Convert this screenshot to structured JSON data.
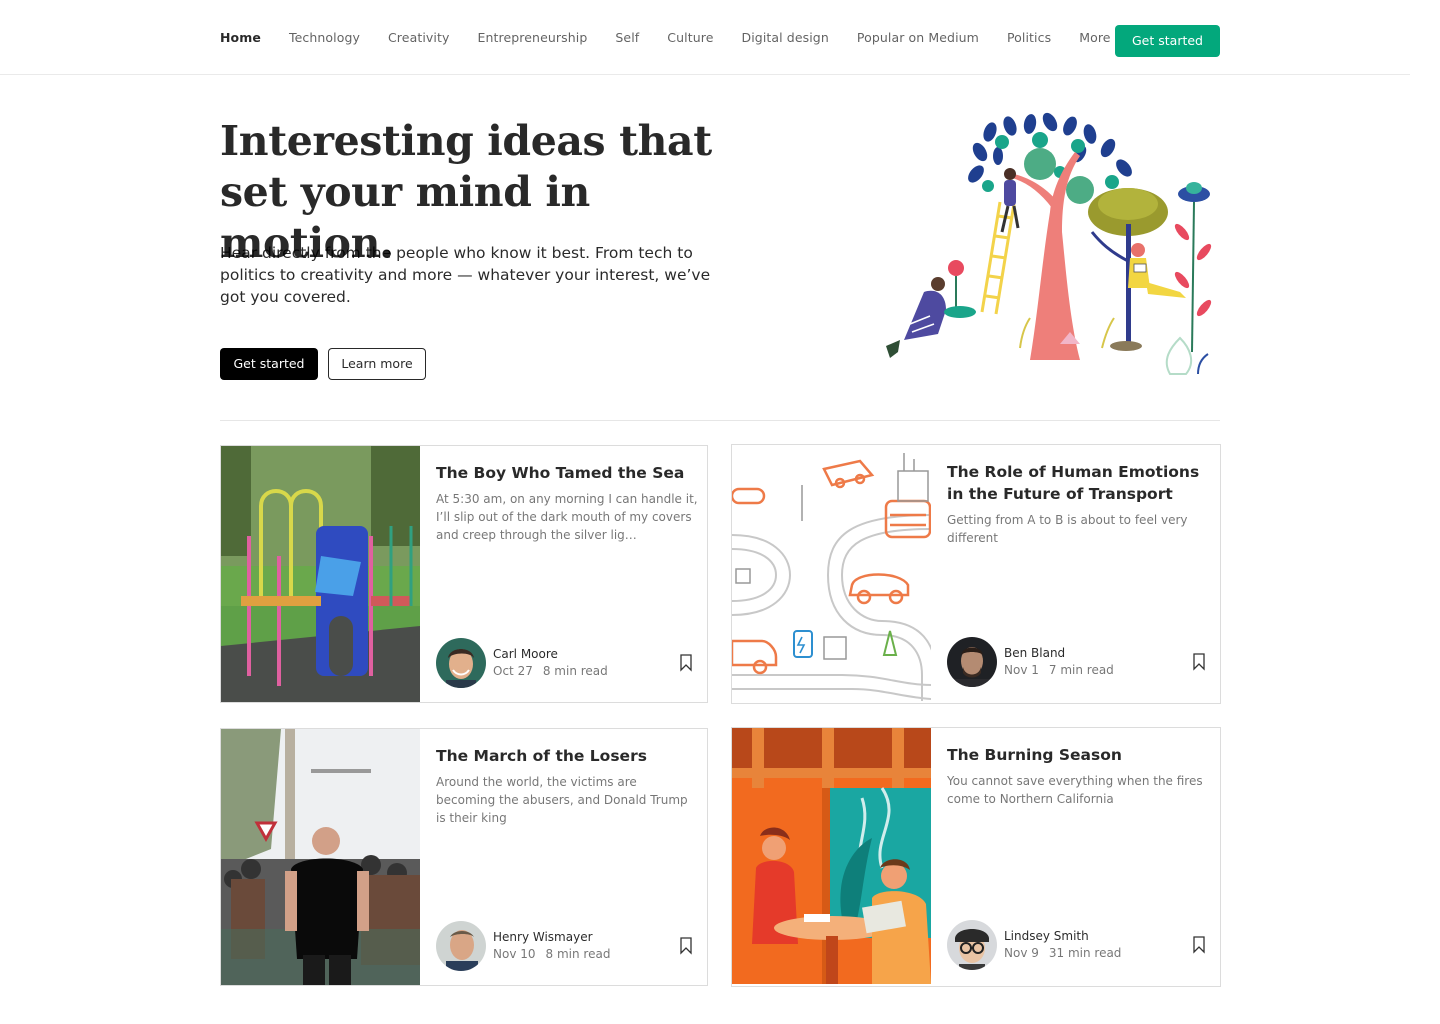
{
  "nav": {
    "items": [
      {
        "label": "Home",
        "active": true
      },
      {
        "label": "Technology"
      },
      {
        "label": "Creativity"
      },
      {
        "label": "Entrepreneurship"
      },
      {
        "label": "Self"
      },
      {
        "label": "Culture"
      },
      {
        "label": "Digital design"
      },
      {
        "label": "Popular on Medium"
      },
      {
        "label": "Politics"
      },
      {
        "label": "More"
      }
    ],
    "cta_label": "Get started"
  },
  "hero": {
    "title": "Interesting ideas that set your mind in motion.",
    "subtitle": "Hear directly from the people who know it best. From tech to politics to creativity and more — whatever your interest, we’ve got you covered.",
    "primary_label": "Get started",
    "secondary_label": "Learn more",
    "illustration_icon": "trees-and-people-illustration"
  },
  "colors": {
    "accent": "#03a87c",
    "text": "rgba(0,0,0,0.84)",
    "muted": "rgba(0,0,0,0.54)"
  },
  "cards": [
    {
      "title": "The Boy Who Tamed the Sea",
      "description": "At 5:30 am, on any morning I can handle it, I’ll slip out of the dark mouth of my covers and creep through the silver lig…",
      "author": "Carl Moore",
      "date": "Oct 27",
      "read_time": "8 min read",
      "image_icon": "playground-photo"
    },
    {
      "title": "The Role of Human Emotions in the Future of Transport",
      "description": "Getting from A to B is about to feel very different",
      "author": "Ben Bland",
      "date": "Nov 1",
      "read_time": "7 min read",
      "image_icon": "transport-roads-illustration"
    },
    {
      "title": "The March of the Losers",
      "description": "Around the world, the victims are becoming the abusers, and Donald Trump is their king",
      "author": "Henry Wismayer",
      "date": "Nov 10",
      "read_time": "8 min read",
      "image_icon": "protest-crowd-photo"
    },
    {
      "title": "The Burning Season",
      "description": "You cannot save everything when the fires come to Northern California",
      "author": "Lindsey Smith",
      "date": "Nov 9",
      "read_time": "31 min read",
      "image_icon": "couple-at-table-illustration"
    }
  ]
}
